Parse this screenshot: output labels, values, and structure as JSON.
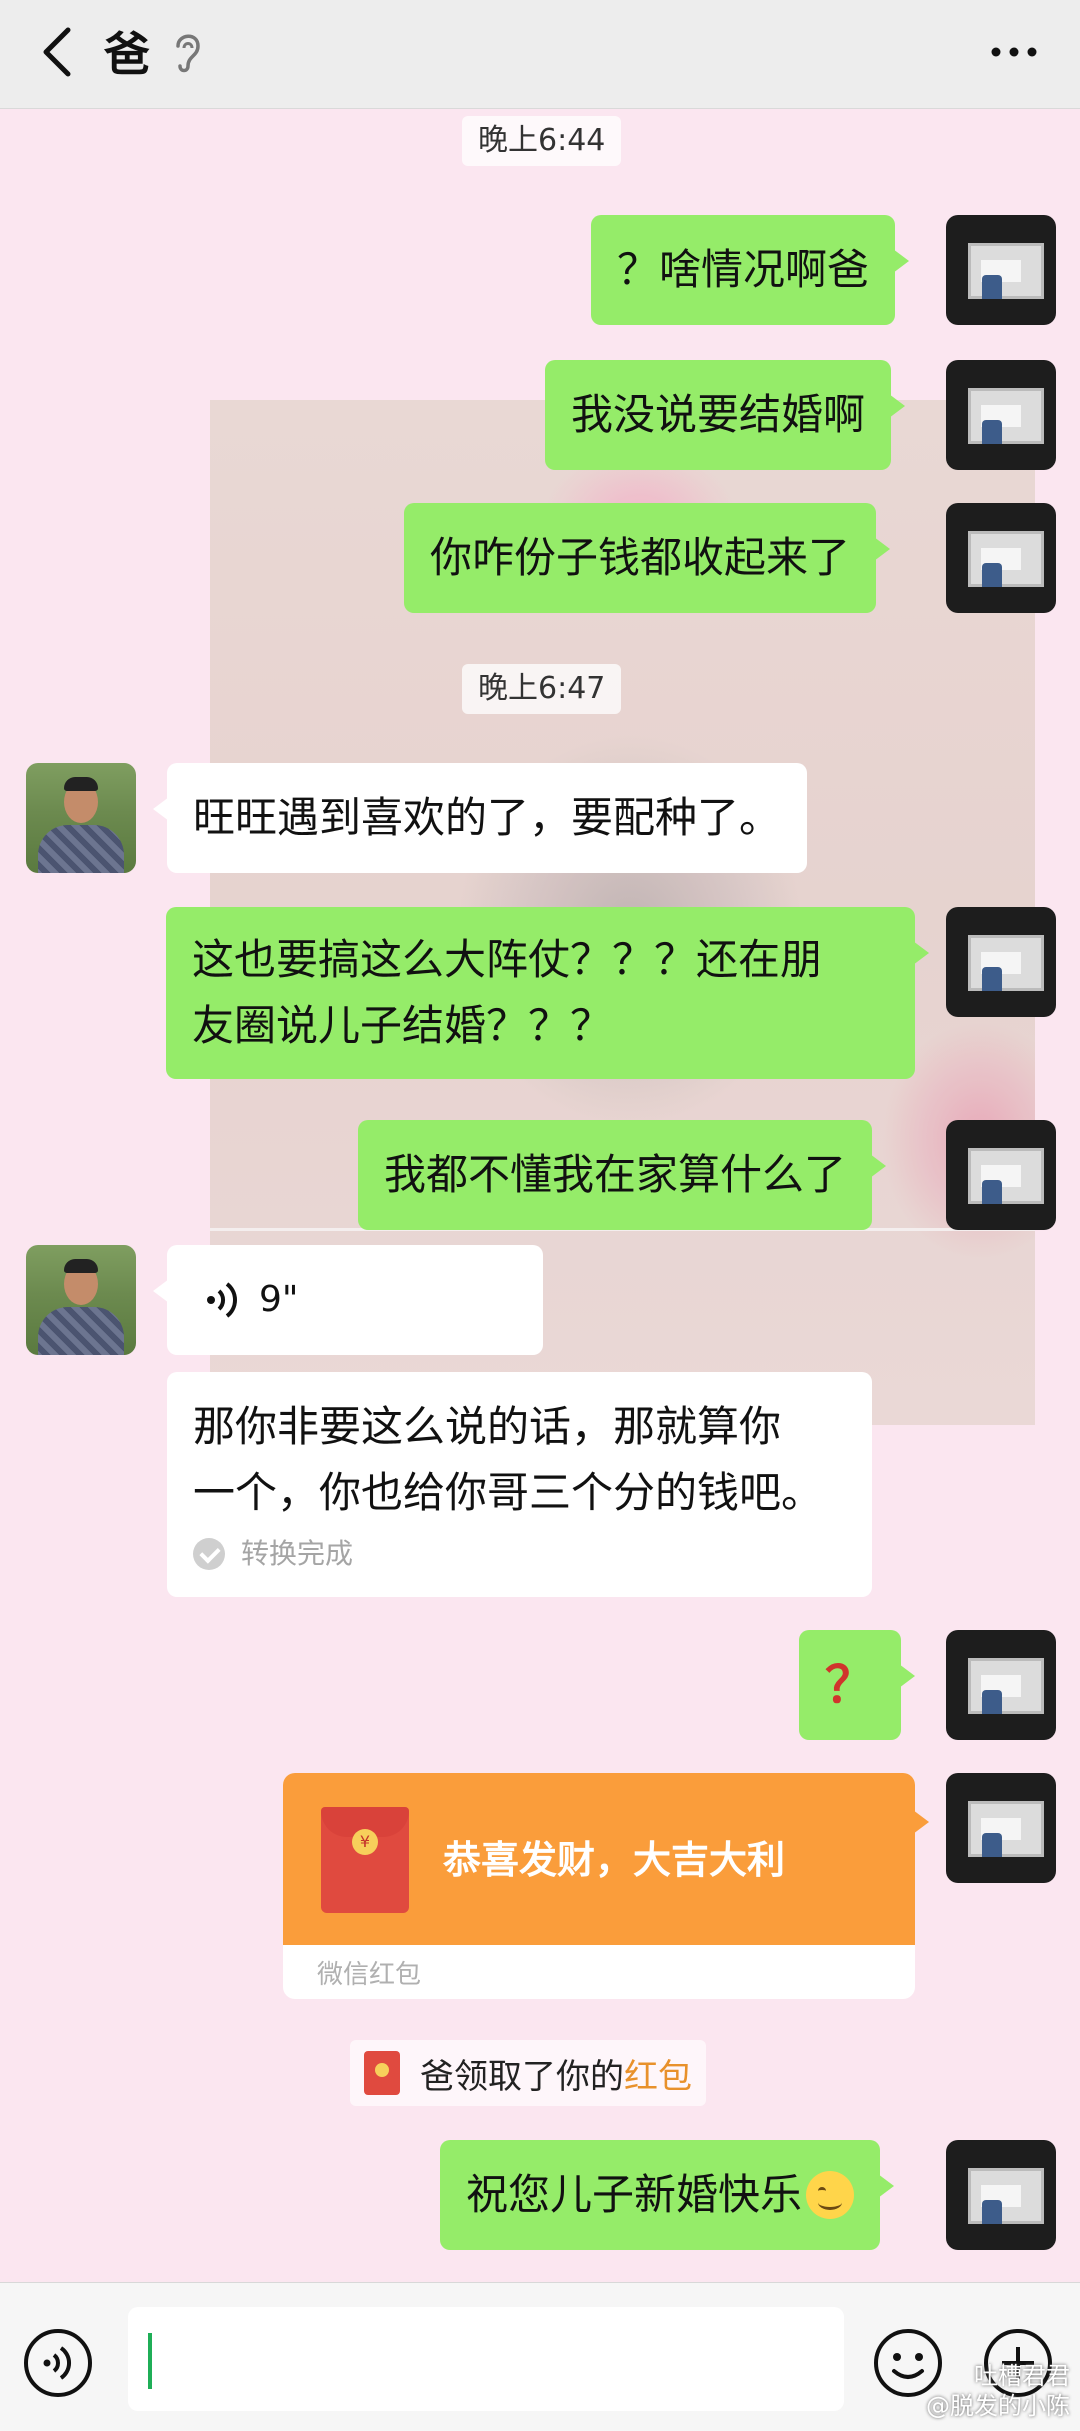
{
  "header": {
    "title": "爸"
  },
  "times": {
    "t1": "晚上6:44",
    "t2": "晚上6:47"
  },
  "messages": {
    "m1": "？啥情况啊爸",
    "m2": "我没说要结婚啊",
    "m3": "你咋份子钱都收起来了",
    "d1": "旺旺遇到喜欢的了，要配种了。",
    "m4_line1": "这也要搞这么大阵仗？？？还在朋",
    "m4_line2": "友圈说儿子结婚？？？",
    "m5": "我都不懂我在家算什么了",
    "voice_duration": "9\"",
    "voice_text_line1": "那你非要这么说的话，那就算你",
    "voice_text_line2": "一个，你也给你哥三个分的钱吧。",
    "voice_status": "转换完成",
    "m6": "？",
    "m7": "祝您儿子新婚快乐"
  },
  "red_packet": {
    "greeting": "恭喜发财，大吉大利",
    "label": "微信红包",
    "coin_symbol": "¥"
  },
  "system_note": {
    "prefix": "爸领取了你的",
    "link": "红包"
  },
  "watermark": {
    "line1": "吐槽君君",
    "line2": "@脱发的小陈"
  },
  "icons": [
    "back-icon",
    "ear-icon",
    "more-icon",
    "voice-wave-icon",
    "check-icon",
    "red-packet-icon",
    "voice-input-icon",
    "emoji-icon",
    "plus-icon"
  ],
  "colors": {
    "my_bubble": "#95ec69",
    "their_bubble": "#ffffff",
    "red_packet": "#fa9d3b",
    "chat_bg": "#fbe6f0"
  }
}
